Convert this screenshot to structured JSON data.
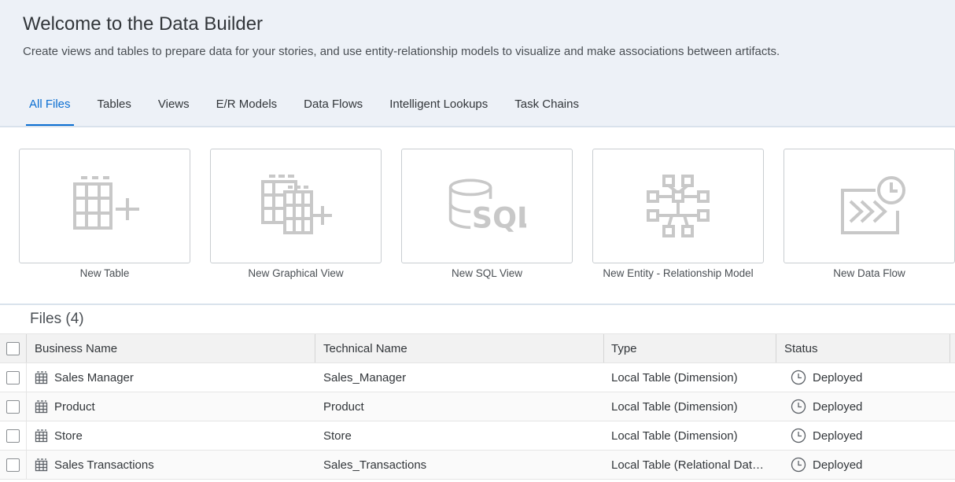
{
  "header": {
    "title": "Welcome to the Data Builder",
    "subtitle": "Create views and tables to prepare data for your stories, and use entity-relationship models to visualize and make associations between artifacts."
  },
  "tabs": [
    {
      "label": "All Files",
      "active": true
    },
    {
      "label": "Tables"
    },
    {
      "label": "Views"
    },
    {
      "label": "E/R Models"
    },
    {
      "label": "Data Flows"
    },
    {
      "label": "Intelligent Lookups"
    },
    {
      "label": "Task Chains"
    }
  ],
  "tiles": [
    {
      "label": "New Table",
      "icon": "new-table-icon"
    },
    {
      "label": "New Graphical View",
      "icon": "graphical-view-icon"
    },
    {
      "label": "New SQL View",
      "icon": "sql-view-icon"
    },
    {
      "label": "New Entity - Relationship Model",
      "icon": "er-model-icon"
    },
    {
      "label": "New Data Flow",
      "icon": "data-flow-icon"
    }
  ],
  "files": {
    "title": "Files (4)",
    "columns": [
      "Business Name",
      "Technical Name",
      "Type",
      "Status"
    ],
    "rows": [
      {
        "business_name": "Sales Manager",
        "technical_name": "Sales_Manager",
        "type": "Local Table (Dimension)",
        "status": "Deployed"
      },
      {
        "business_name": "Product",
        "technical_name": "Product",
        "type": "Local Table (Dimension)",
        "status": "Deployed"
      },
      {
        "business_name": "Store",
        "technical_name": "Store",
        "type": "Local Table (Dimension)",
        "status": "Deployed"
      },
      {
        "business_name": "Sales Transactions",
        "technical_name": "Sales_Transactions",
        "type": "Local Table (Relational Dat…",
        "status": "Deployed"
      }
    ]
  },
  "colors": {
    "accent": "#0a6ed1",
    "header_bg": "#edf1f7",
    "icon_gray": "#c8c8c8"
  }
}
